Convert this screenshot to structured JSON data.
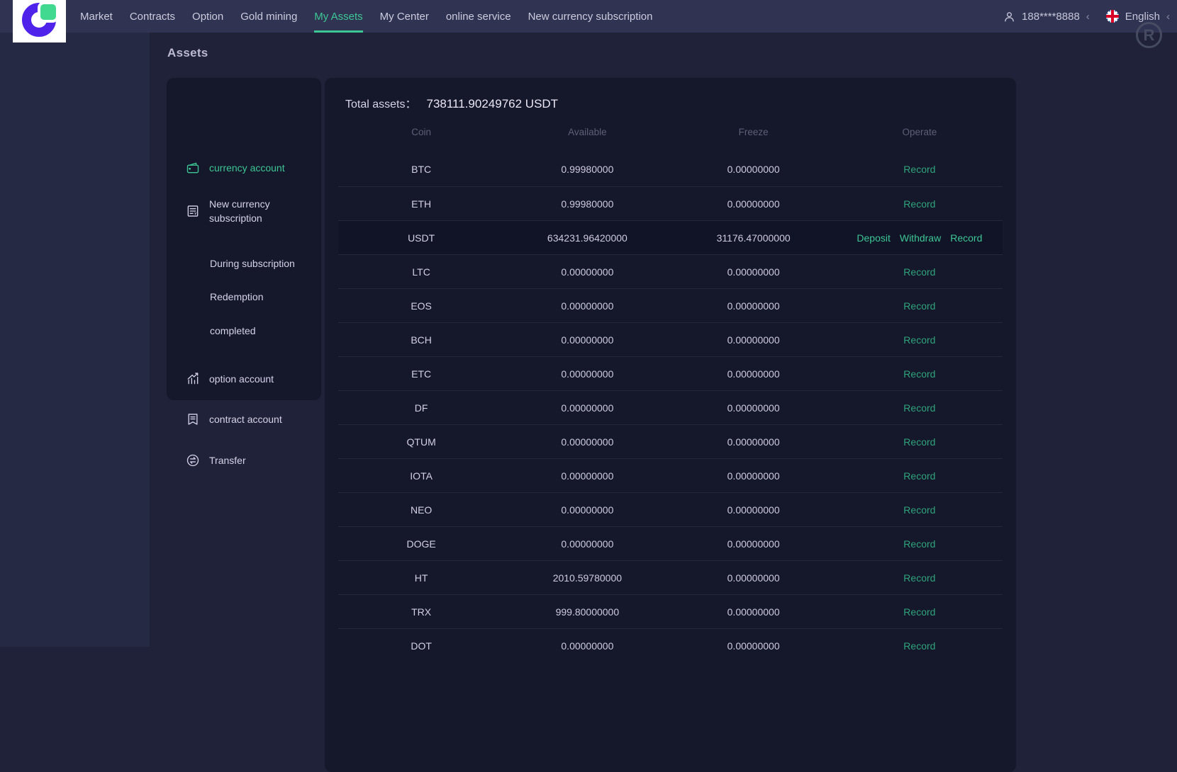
{
  "nav": {
    "items": [
      {
        "label": "Market"
      },
      {
        "label": "Contracts"
      },
      {
        "label": "Option"
      },
      {
        "label": "Gold mining"
      },
      {
        "label": "My Assets",
        "active": true
      },
      {
        "label": "My Center"
      },
      {
        "label": "online service"
      },
      {
        "label": "New currency subscription"
      }
    ],
    "phone": "188****8888",
    "phone_chevron": "‹",
    "language": "English",
    "language_chevron": "‹",
    "watermark": "R"
  },
  "page": {
    "title": "Assets"
  },
  "sidebar": {
    "items": [
      {
        "label": "currency account",
        "icon": "wallet-icon",
        "active": true
      },
      {
        "label": "New currency subscription",
        "icon": "subscription-doc-icon"
      },
      {
        "label": "During subscription",
        "sub": true
      },
      {
        "label": "Redemption",
        "sub": true
      },
      {
        "label": "completed",
        "sub": true
      },
      {
        "label": "option account",
        "icon": "chart-growth-icon"
      },
      {
        "label": "contract account",
        "icon": "contract-doc-icon"
      },
      {
        "label": "Transfer",
        "icon": "transfer-arrows-icon"
      }
    ]
  },
  "assets": {
    "total_label": "Total assets：",
    "total_value": "738111.90249762 USDT",
    "columns": [
      "Coin",
      "Available",
      "Freeze",
      "Operate"
    ],
    "rows": [
      {
        "coin": "BTC",
        "available": "0.99980000",
        "freeze": "0.00000000",
        "ops": [
          "Record"
        ]
      },
      {
        "coin": "ETH",
        "available": "0.99980000",
        "freeze": "0.00000000",
        "ops": [
          "Record"
        ]
      },
      {
        "coin": "USDT",
        "available": "634231.96420000",
        "freeze": "31176.47000000",
        "ops": [
          "Deposit",
          "Withdraw",
          "Record"
        ],
        "highlight": true
      },
      {
        "coin": "LTC",
        "available": "0.00000000",
        "freeze": "0.00000000",
        "ops": [
          "Record"
        ]
      },
      {
        "coin": "EOS",
        "available": "0.00000000",
        "freeze": "0.00000000",
        "ops": [
          "Record"
        ]
      },
      {
        "coin": "BCH",
        "available": "0.00000000",
        "freeze": "0.00000000",
        "ops": [
          "Record"
        ]
      },
      {
        "coin": "ETC",
        "available": "0.00000000",
        "freeze": "0.00000000",
        "ops": [
          "Record"
        ]
      },
      {
        "coin": "DF",
        "available": "0.00000000",
        "freeze": "0.00000000",
        "ops": [
          "Record"
        ]
      },
      {
        "coin": "QTUM",
        "available": "0.00000000",
        "freeze": "0.00000000",
        "ops": [
          "Record"
        ]
      },
      {
        "coin": "IOTA",
        "available": "0.00000000",
        "freeze": "0.00000000",
        "ops": [
          "Record"
        ]
      },
      {
        "coin": "NEO",
        "available": "0.00000000",
        "freeze": "0.00000000",
        "ops": [
          "Record"
        ]
      },
      {
        "coin": "DOGE",
        "available": "0.00000000",
        "freeze": "0.00000000",
        "ops": [
          "Record"
        ]
      },
      {
        "coin": "HT",
        "available": "2010.59780000",
        "freeze": "0.00000000",
        "ops": [
          "Record"
        ]
      },
      {
        "coin": "TRX",
        "available": "999.80000000",
        "freeze": "0.00000000",
        "ops": [
          "Record"
        ]
      },
      {
        "coin": "DOT",
        "available": "0.00000000",
        "freeze": "0.00000000",
        "ops": [
          "Record"
        ]
      }
    ]
  },
  "colors": {
    "nav_bg": "#303351",
    "page_bg": "#1f2238",
    "strip_bg": "#252944",
    "card_bg": "#15172a",
    "accent_green": "#3cc795",
    "record_green": "#2fa47c",
    "logo_purple": "#4f23e9",
    "logo_green": "#41d98f"
  }
}
